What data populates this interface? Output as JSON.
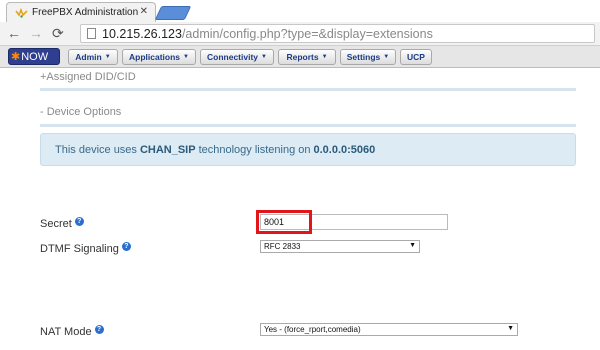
{
  "browser": {
    "tab_title": "FreePBX Administration",
    "tab_close": "✕",
    "url_host": "10.215.26.123",
    "url_path": "/admin/config.php?type=&display=extensions"
  },
  "menubar": {
    "logo_text": "NOW",
    "items": [
      {
        "label": "Admin"
      },
      {
        "label": "Applications"
      },
      {
        "label": "Connectivity"
      },
      {
        "label": "Reports"
      },
      {
        "label": "Settings"
      },
      {
        "label": "UCP"
      }
    ]
  },
  "sections": {
    "assigned_did": "+Assigned DID/CID",
    "device_options": "- Device Options"
  },
  "info": {
    "prefix": "This device uses",
    "technology": "CHAN_SIP",
    "middle": "technology listening on",
    "address": "0.0.0.0:5060"
  },
  "fields": {
    "secret_label": "Secret",
    "secret_value": "8001",
    "dtmf_label": "DTMF Signaling",
    "dtmf_value": "RFC 2833",
    "nat_label": "NAT Mode",
    "nat_value": "Yes - (force_rport,comedia)"
  },
  "icons": {
    "help": "?",
    "dropdown": "▼",
    "menu_caret": "▼"
  },
  "colors": {
    "highlight": "#e0161b",
    "info_background": "#dcebf4",
    "menu_text": "#1b3b85",
    "logo_background": "#2f3f8f"
  }
}
